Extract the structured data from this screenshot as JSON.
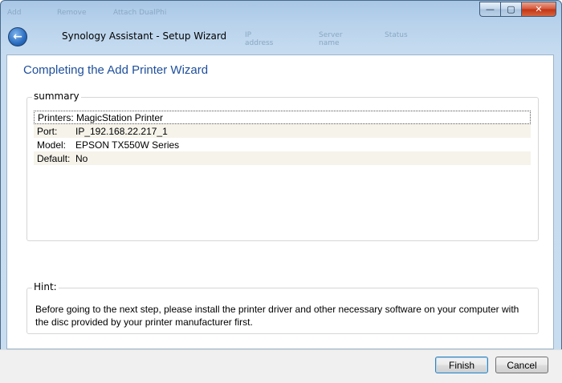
{
  "window": {
    "title": "Synology Assistant - Setup Wizard",
    "background_text": [
      "Add",
      "Remove",
      "Attach DualPhi"
    ],
    "background_columns": [
      "IP address",
      "Server name",
      "Status"
    ],
    "caption_buttons": {
      "minimize": "—",
      "maximize": "▢",
      "close": "✕"
    },
    "back_icon": "back-arrow-icon"
  },
  "wizard": {
    "heading": "Completing the Add Printer Wizard",
    "summary": {
      "legend": "summary",
      "rows": [
        {
          "label": "Printers:",
          "value": "MagicStation Printer"
        },
        {
          "label": "Port:",
          "value": "IP_192.168.22.217_1"
        },
        {
          "label": "Model:",
          "value": "EPSON TX550W Series"
        },
        {
          "label": "Default:",
          "value": "No"
        }
      ]
    },
    "hint": {
      "legend": "Hint:",
      "text": "Before going to the next step, please install the printer driver and other necessary software on your computer with the disc provided by your printer manufacturer first."
    }
  },
  "footer": {
    "finish_label": "Finish",
    "cancel_label": "Cancel"
  }
}
